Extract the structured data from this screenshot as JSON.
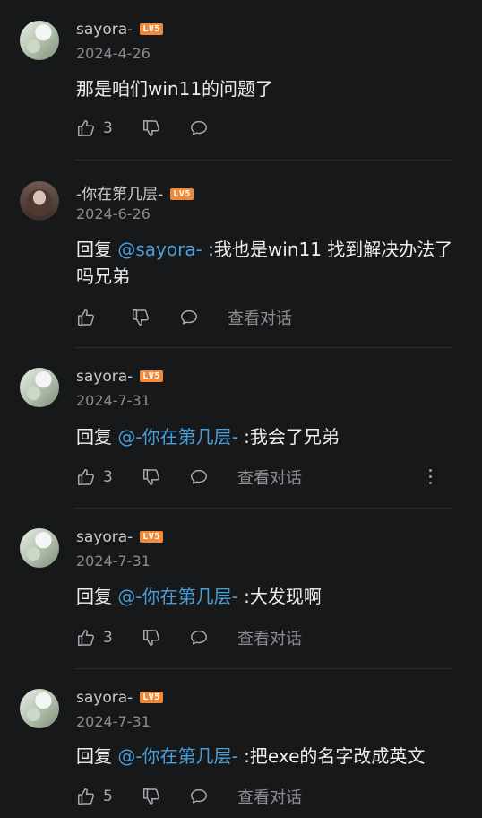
{
  "comments": [
    {
      "username": "sayora-",
      "level": "LV5",
      "date": "2024-4-26",
      "reply_prefix": "",
      "mention": "",
      "text": "那是咱们win11的问题了",
      "likes": "3",
      "view_thread": ""
    },
    {
      "username": "-你在第几层-",
      "level": "LV5",
      "date": "2024-6-26",
      "reply_prefix": "回复 ",
      "mention": "@sayora-",
      "text": " :我也是win11 找到解决办法了吗兄弟",
      "likes": "",
      "view_thread": "查看对话"
    },
    {
      "username": "sayora-",
      "level": "LV5",
      "date": "2024-7-31",
      "reply_prefix": "回复 ",
      "mention": "@-你在第几层-",
      "text": " :我会了兄弟",
      "likes": "3",
      "view_thread": "查看对话"
    },
    {
      "username": "sayora-",
      "level": "LV5",
      "date": "2024-7-31",
      "reply_prefix": "回复 ",
      "mention": "@-你在第几层-",
      "text": " :大发现啊",
      "likes": "3",
      "view_thread": "查看对话"
    },
    {
      "username": "sayora-",
      "level": "LV5",
      "date": "2024-7-31",
      "reply_prefix": "回复 ",
      "mention": "@-你在第几层-",
      "text": " :把exe的名字改成英文",
      "likes": "5",
      "view_thread": "查看对话"
    }
  ],
  "icons": {
    "like": "thumbs-up-icon",
    "dislike": "thumbs-down-icon",
    "reply": "comment-bubble-icon",
    "more": "more-vertical-icon"
  },
  "colors": {
    "background": "#17181a",
    "mention": "#4a9eda",
    "level_badge": "#f08a3a"
  }
}
